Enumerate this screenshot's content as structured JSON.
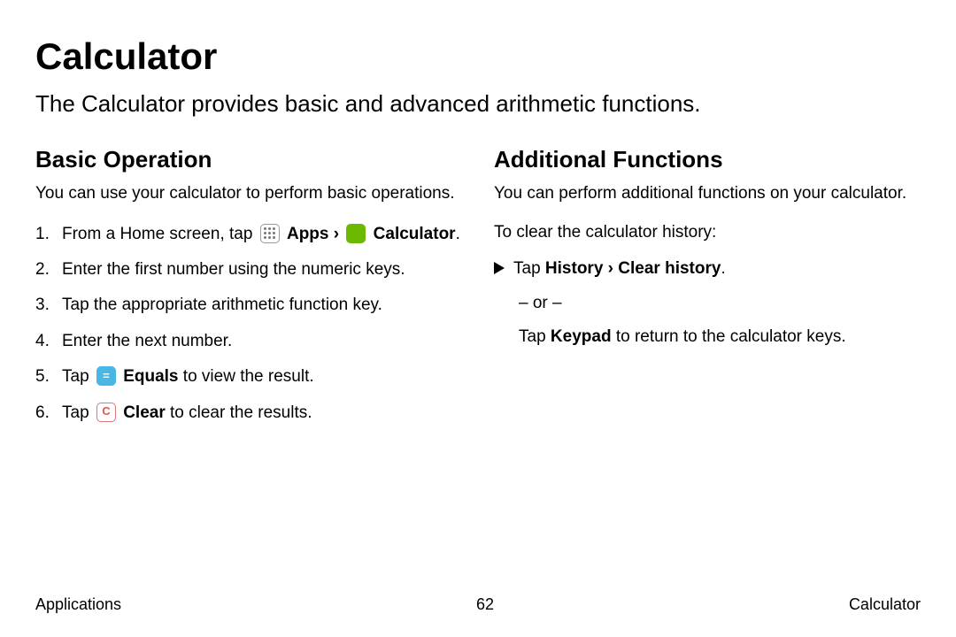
{
  "title": "Calculator",
  "intro": "The Calculator provides basic and advanced arithmetic functions.",
  "left": {
    "heading": "Basic Operation",
    "lead": "You can use your calculator to perform basic operations.",
    "s1a": "From a Home screen, tap ",
    "apps": "Apps",
    "arrow": "›",
    "calc": "Calculator",
    "period": ".",
    "s2": "Enter the first number using the numeric keys.",
    "s3": "Tap the appropriate arithmetic function key.",
    "s4": "Enter the next number.",
    "s5a": "Tap ",
    "equals": "Equals",
    "s5b": " to view the result.",
    "s6a": "Tap ",
    "clear": "Clear",
    "s6b": " to clear the results."
  },
  "right": {
    "heading": "Additional Functions",
    "lead": "You can perform additional functions on your calculator.",
    "sub": "To clear the calculator history:",
    "b1a": "Tap ",
    "hist": "History",
    "arrow": "›",
    "ch": "Clear history",
    "period": ".",
    "or": "– or –",
    "b2a": "Tap ",
    "keypad": "Keypad",
    "b2b": " to return to the calculator keys."
  },
  "footer": {
    "left": "Applications",
    "center": "62",
    "right": "Calculator"
  },
  "glyph": {
    "equals": "=",
    "clear": "C",
    "calc": ""
  }
}
